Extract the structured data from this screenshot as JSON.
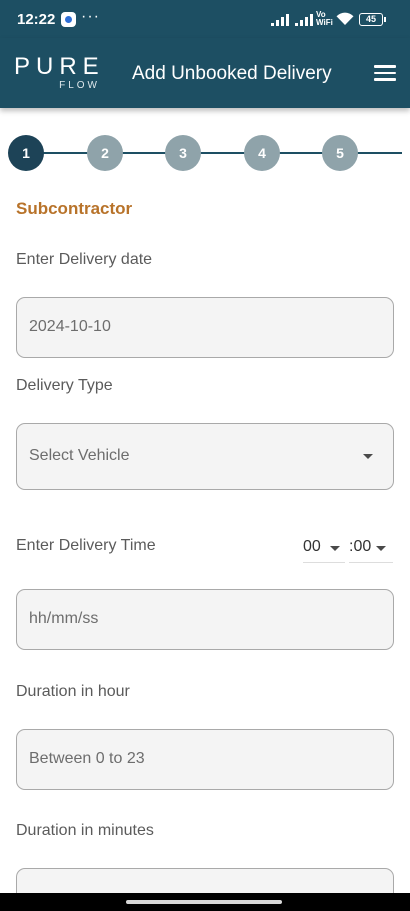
{
  "status_bar": {
    "time": "12:22",
    "dots": "···",
    "vo_wifi_top": "Vo",
    "vo_wifi_bottom": "WiFi",
    "battery": "45"
  },
  "app_bar": {
    "logo_main": "PURE",
    "logo_sub": "FLOW",
    "title": "Add Unbooked Delivery"
  },
  "stepper": {
    "steps": [
      "1",
      "2",
      "3",
      "4",
      "5"
    ],
    "active_step": "1"
  },
  "form": {
    "section_title": "Subcontractor",
    "delivery_date": {
      "label": "Enter Delivery date",
      "value": "2024-10-10"
    },
    "delivery_type": {
      "label": "Delivery Type",
      "placeholder": "Select Vehicle"
    },
    "delivery_time": {
      "label": "Enter Delivery Time",
      "hour": "00",
      "minute": ":00",
      "placeholder": "hh/mm/ss"
    },
    "duration_hour": {
      "label": "Duration in hour",
      "placeholder": "Between 0 to 23"
    },
    "duration_minutes": {
      "label": "Duration in minutes"
    }
  },
  "colors": {
    "primary": "#1d4f63",
    "accent": "#b8732a",
    "step_inactive": "#8fa3aa"
  }
}
